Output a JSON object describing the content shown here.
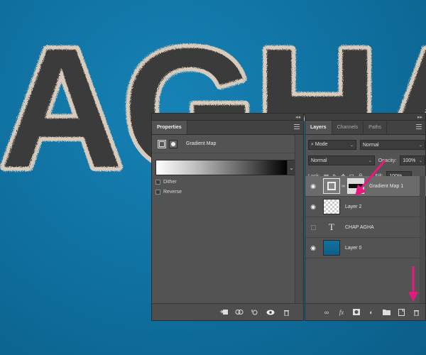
{
  "canvas": {
    "text": "AGHA"
  },
  "properties_panel": {
    "tab_label": "Properties",
    "adjustment_title": "Gradient Map",
    "dither_label": "Dither",
    "reverse_label": "Reverse",
    "icons": [
      "adjustment-icon",
      "mask-icon",
      "clip-to-layer-icon",
      "view-previous-state-icon",
      "reset-icon",
      "visibility-icon",
      "delete-icon"
    ]
  },
  "layers_panel": {
    "tabs": [
      {
        "label": "Layers"
      },
      {
        "label": "Channels"
      },
      {
        "label": "Paths"
      }
    ],
    "filter_kind": "Mode",
    "filter_mode": "Normal",
    "blend_mode": "Normal",
    "opacity_label": "Opacity:",
    "opacity_value": "100%",
    "lock_label": "Lock:",
    "fill_label": "Fill:",
    "fill_value": "100%",
    "layers": [
      {
        "name": "Gradient Map 1",
        "visible": true,
        "selected": true,
        "kind": "adjustment"
      },
      {
        "name": "Layer 2",
        "visible": true,
        "selected": false,
        "kind": "pixel"
      },
      {
        "name": "CHAP AGHA",
        "visible": false,
        "selected": false,
        "kind": "type"
      },
      {
        "name": "Layer 0",
        "visible": true,
        "selected": false,
        "kind": "pixel"
      }
    ]
  },
  "colors": {
    "annotation_arrow": "#e8197d",
    "canvas_bg": "#0f6f9e",
    "panel_bg": "#535353"
  }
}
